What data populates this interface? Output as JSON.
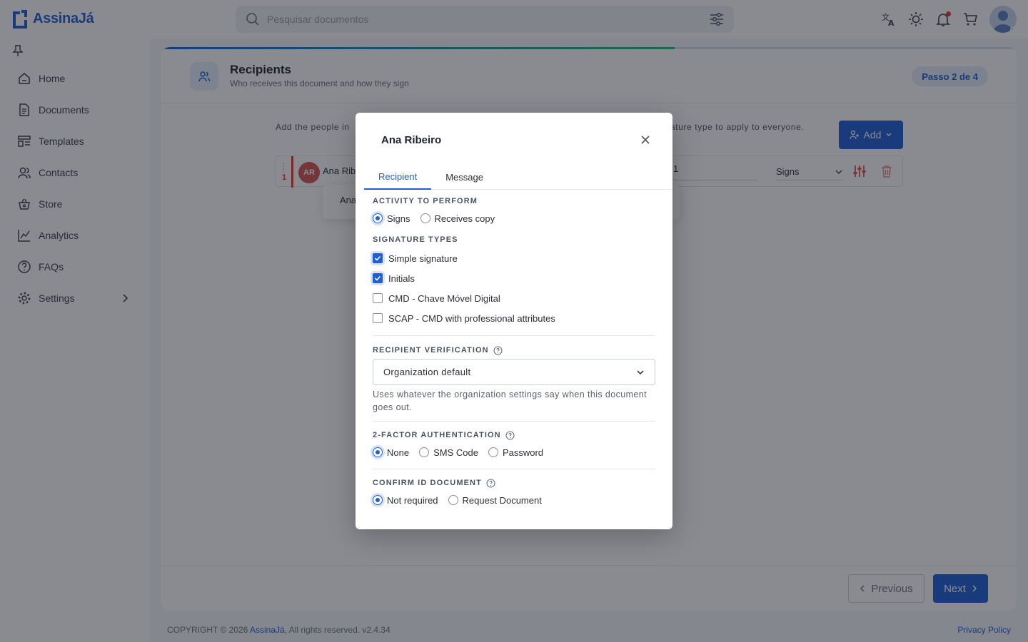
{
  "app": {
    "name": "AssinaJá"
  },
  "search": {
    "placeholder": "Pesquisar documentos"
  },
  "sidebar": {
    "items": [
      {
        "label": "Home",
        "icon": "home-icon"
      },
      {
        "label": "Documents",
        "icon": "document-icon"
      },
      {
        "label": "Templates",
        "icon": "templates-icon"
      },
      {
        "label": "Contacts",
        "icon": "contacts-icon"
      },
      {
        "label": "Store",
        "icon": "store-icon"
      },
      {
        "label": "Analytics",
        "icon": "analytics-icon"
      },
      {
        "label": "FAQs",
        "icon": "help-icon"
      },
      {
        "label": "Settings",
        "icon": "gear-icon"
      }
    ]
  },
  "page": {
    "title": "Recipients",
    "subtitle": "Who receives this document and how they sign",
    "step": "Passo 2 de 4",
    "instruction_left": "Add the people in",
    "instruction_right": "ature type to apply to everyone.",
    "add_label": "Add",
    "recipient": {
      "order": "1",
      "initials": "AR",
      "name": "Ana Ribe",
      "order_value": "1",
      "role": "Signs"
    },
    "popup_text": "Ana",
    "previous_label": "Previous",
    "next_label": "Next"
  },
  "footer": {
    "copyright_prefix": "COPYRIGHT © 2026 ",
    "brand": "AssinaJá",
    "copyright_suffix": ", All rights reserved.",
    "version": " v2.4.34",
    "privacy": "Privacy Policy"
  },
  "modal": {
    "title": "Ana Ribeiro",
    "tabs": [
      "Recipient",
      "Message"
    ],
    "activity": {
      "label": "ACTIVITY TO PERFORM",
      "options": [
        "Signs",
        "Receives copy"
      ],
      "selected": "Signs"
    },
    "signature_types": {
      "label": "SIGNATURE TYPES",
      "options": [
        {
          "label": "Simple signature",
          "checked": true
        },
        {
          "label": "Initials",
          "checked": true
        },
        {
          "label": "CMD - Chave Móvel Digital",
          "checked": false
        },
        {
          "label": "SCAP - CMD with professional attributes",
          "checked": false
        }
      ]
    },
    "verification": {
      "label": "RECIPIENT VERIFICATION",
      "value": "Organization default",
      "hint": "Uses whatever the organization settings say when this document goes out."
    },
    "two_factor": {
      "label": "2-FACTOR AUTHENTICATION",
      "options": [
        "None",
        "SMS Code",
        "Password"
      ],
      "selected": "None"
    },
    "confirm_id": {
      "label": "CONFIRM ID DOCUMENT",
      "options": [
        "Not required",
        "Request Document"
      ],
      "selected": "Not required"
    }
  },
  "colors": {
    "primary": "#1f5fd6",
    "danger": "#e53935",
    "success": "#2eb872"
  }
}
